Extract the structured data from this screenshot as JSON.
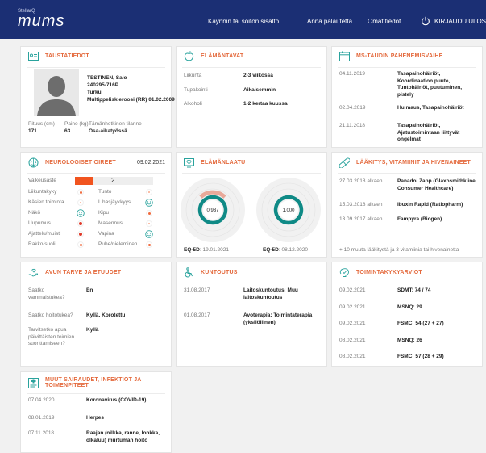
{
  "nav": {
    "logo_top": "StellarQ",
    "logo_main": "mums",
    "links": [
      "Käynnin tai soiton sisältö",
      "Anna palautetta",
      "Omat tiedot"
    ],
    "logout": "KIRJAUDU ULOS"
  },
  "basic": {
    "title": "TAUSTATIEDOT",
    "name": "TESTINEN, Salo",
    "id": "240295-716P",
    "city": "Turku",
    "diagnosis": "Multippeliskleroosi (RR) 01.02.2009",
    "height_label": "Pituus (cm)",
    "weight_label": "Paino (kg)",
    "status_label": "Tämänhetkinen tilanne",
    "height": "171",
    "weight": "63",
    "status": "Osa-aikatyössä"
  },
  "lifestyle": {
    "title": "ELÄMÄNTAVAT",
    "rows": [
      {
        "label": "Liikunta",
        "value": "2-3 viikossa"
      },
      {
        "label": "Tupakointi",
        "value": "Aikaisemmin"
      },
      {
        "label": "Alkoholi",
        "value": "1-2 kertaa kuussa"
      }
    ]
  },
  "relapses": {
    "title": "MS-TAUDIN PAHENEMISVAIHE",
    "rows": [
      {
        "date": "04.11.2019",
        "text": "Tasapainohäiriöt, Koordinaation puute, Tuntohäiriöt, puutuminen, pistely"
      },
      {
        "date": "02.04.2019",
        "text": "Huimaus, Tasapainohäiriöt"
      },
      {
        "date": "21.11.2018",
        "text": "Tasapainohäiriöt, Ajatustoimintaan liittyvät ongelmat"
      }
    ]
  },
  "neuro": {
    "title": "NEUROLOGISET OIREET",
    "date": "09.02.2021",
    "severity_label": "Vaikeusaste",
    "severity_value": "2",
    "left": [
      "Liikuntakyky",
      "Käsien toiminta",
      "Näkö",
      "Uupumus",
      "Ajattelu/muisti",
      "Rakko/suoli"
    ],
    "right": [
      "Tunto",
      "Lihasjäykkyys",
      "Kipu",
      "Masennus",
      "Vapina",
      "Puhe/nieleminen"
    ]
  },
  "qol": {
    "title": "ELÄMÄNLAATU",
    "v1": "0.937",
    "v2": "1.000",
    "label1": "EQ-5D",
    "date1": ": 19.01.2021",
    "label2": "EQ-5D",
    "date2": ": 08.12.2020"
  },
  "meds": {
    "title": "LÄÄKITYS, VITAMIINIT JA HIVENAINEET",
    "rows": [
      {
        "date": "27.03.2018 alkaen",
        "name": "Panadol Zapp (Glaxosmithkline Consumer Healthcare)"
      },
      {
        "date": "15.03.2018 alkaen",
        "name": "Ibuxin Rapid (Ratiopharm)"
      },
      {
        "date": "13.09.2017 alkaen",
        "name": "Fampyra (Biogen)"
      }
    ],
    "more": "+ 10 muuta lääkitystä ja 3 vitamiinia tai hivenainetta"
  },
  "help": {
    "title": "AVUN TARVE JA ETUUDET",
    "q1": "Saatko vammaistukea?",
    "a1": "En",
    "q2": "Saatko hoitotukea?",
    "a2": "Kyllä, Korotettu",
    "q3": "Tarvitsetko apua päivittäisten toimien suorittamiseen?",
    "a3": "Kyllä"
  },
  "rehab": {
    "title": "KUNTOUTUS",
    "rows": [
      {
        "date": "31.08.2017",
        "text": "Laitoskuntoutus: Muu laitoskuntoutus"
      },
      {
        "date": "01.08.2017",
        "text": "Avoterapia: Toimintaterapia (yksilöllinen)"
      }
    ]
  },
  "func": {
    "title": "TOIMINTAKYKYARVIOT",
    "rows": [
      {
        "date": "09.02.2021",
        "text": "SDMT: 74 / 74"
      },
      {
        "date": "09.02.2021",
        "text": "MSNQ: 29"
      },
      {
        "date": "09.02.2021",
        "text": "FSMC: 54 (27 + 27)"
      },
      {
        "date": "08.02.2021",
        "text": "MSNQ: 26"
      },
      {
        "date": "08.02.2021",
        "text": "FSMC: 57 (28 + 29)"
      }
    ]
  },
  "other": {
    "title": "MUUT SAIRAUDET, INFEKTIOT JA TOIMENPITEET",
    "rows": [
      {
        "date": "07.04.2020",
        "text": "Koronavirus (COVID-19)"
      },
      {
        "date": "08.01.2019",
        "text": "Herpes"
      },
      {
        "date": "07.11.2018",
        "text": "Raajan (nilkka, ranne, lonkka, olkaluu) murtuman hoito"
      }
    ]
  },
  "colors": {
    "nav": "#1b2f74",
    "accent": "#e46a3d",
    "ring": "#0f8a86",
    "severity": "#f1541f",
    "smiley": "#2aa39d"
  }
}
